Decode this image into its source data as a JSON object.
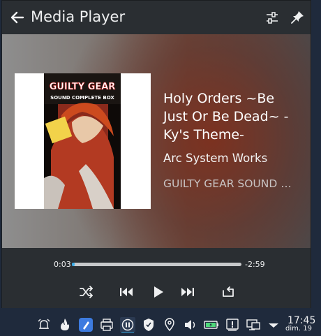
{
  "header": {
    "title": "Media Player",
    "back_icon": "arrow-left-icon",
    "configure_icon": "settings-sliders-icon",
    "pin_icon": "pin-icon"
  },
  "track": {
    "title": "Holy Orders ~Be Just Or Be Dead~ -Ky's Theme-",
    "artist": "Arc System Works",
    "album": "GUILTY GEAR SOUND COMPLETE BOX"
  },
  "cover": {
    "title_line1": "GUILTY GEAR",
    "title_line2": "SOUND COMPLETE BOX"
  },
  "progress": {
    "elapsed": "0:03",
    "remaining": "-2:59",
    "fraction": 0.017
  },
  "controls": {
    "shuffle_icon": "shuffle-icon",
    "previous_icon": "skip-previous-icon",
    "play_icon": "play-icon",
    "next_icon": "skip-next-icon",
    "repeat_icon": "repeat-icon"
  },
  "colors": {
    "accent": "#3daee9",
    "panel": "#2a2e32",
    "taskbar": "#1f2a3c"
  },
  "taskbar": {
    "tray_icons": [
      "alarm-icon",
      "flame-icon",
      "blue-pen-icon",
      "printer-icon",
      "pause-circle-icon",
      "shield-icon",
      "location-pin-icon",
      "volume-icon",
      "battery-icon",
      "notification-icon",
      "display-icon",
      "chevron-down-icon"
    ],
    "clock_time": "17:45",
    "clock_date": "dim. 19"
  }
}
